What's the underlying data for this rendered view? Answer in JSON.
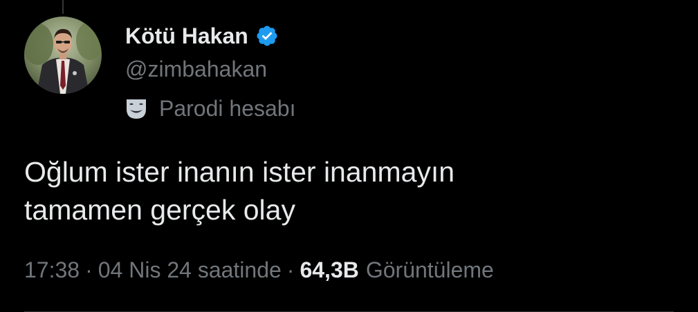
{
  "author": {
    "display_name": "Kötü Hakan",
    "handle": "@zimbahakan",
    "verified": true,
    "label": "Parodi hesabı"
  },
  "tweet": {
    "lines": [
      "Oğlum ister inanın ister inanmayın",
      "tamamen gerçek olay"
    ]
  },
  "meta": {
    "time": "17:38",
    "date": "04 Nis 24 saatinde",
    "separator": "·",
    "views_count": "64,3B",
    "views_label": "Görüntüleme"
  },
  "icons": {
    "verified": "verified-badge-icon",
    "label": "parody-mask-icon"
  },
  "colors": {
    "background": "#000000",
    "primary_text": "#e7e9ea",
    "secondary_text": "#71767b",
    "verified_blue": "#1d9bf0"
  }
}
